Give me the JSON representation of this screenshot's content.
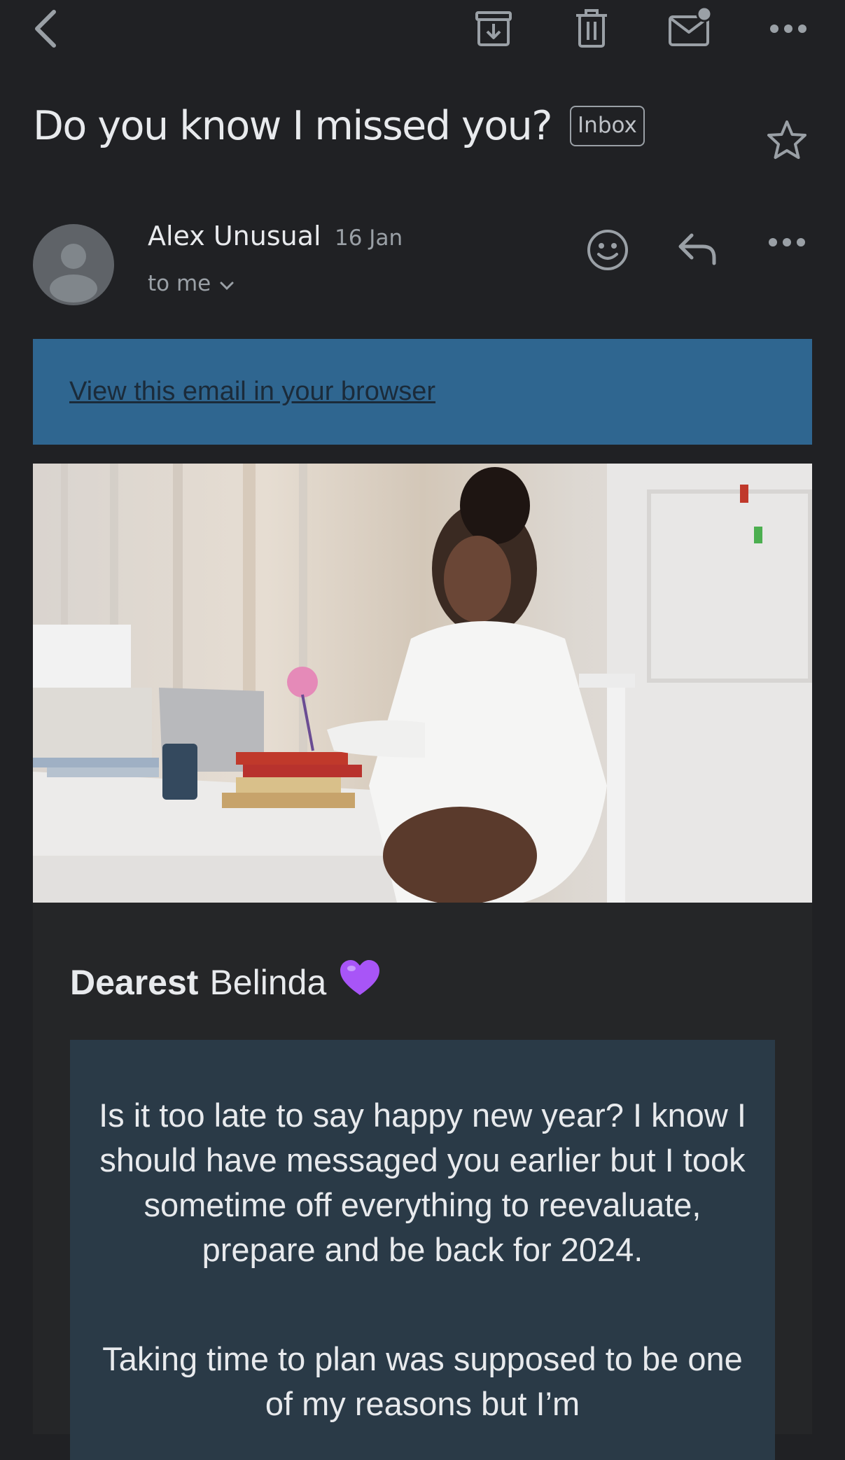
{
  "toolbar": {
    "icons": [
      "back-icon",
      "archive-icon",
      "delete-icon",
      "mark-unread-icon",
      "more-icon"
    ]
  },
  "email": {
    "subject": "Do you know I missed you?",
    "label": "Inbox",
    "sender": {
      "name": "Alex Unusual",
      "date": "16 Jan",
      "recipient": "to me"
    }
  },
  "body": {
    "browser_link": "View this email in your browser",
    "greeting_bold": "Dearest",
    "greeting_name": "Belinda",
    "greeting_emoji": "💜",
    "paragraph_1": "Is it too late to say happy new year? I know I should have messaged you earlier but I took sometime off everything to reevaluate, prepare and be back for 2024.",
    "paragraph_2": "Taking time to plan was supposed to be one of my reasons but I’m"
  },
  "colors": {
    "background": "#202124",
    "banner": "#2f6690",
    "message_box": "#2a3a47",
    "text": "#e8eaed",
    "muted": "#9aa0a6"
  }
}
